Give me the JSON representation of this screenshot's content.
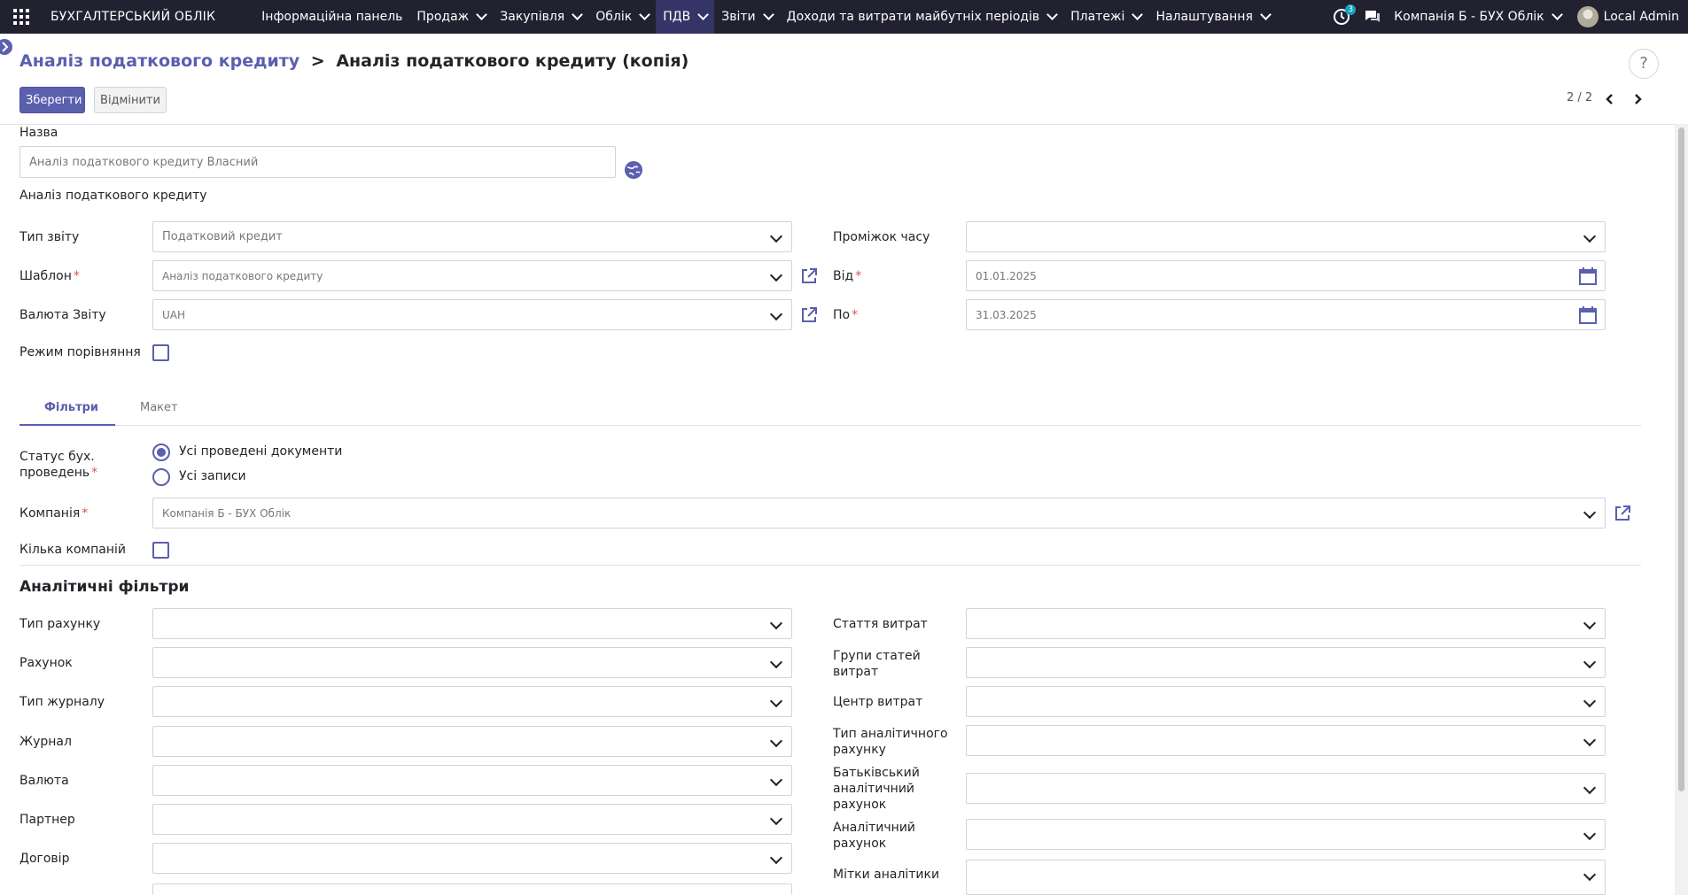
{
  "topbar": {
    "brand": "БУХГАЛТЕРСЬКИЙ ОБЛІК",
    "menu": [
      {
        "label": "Інформаційна панель",
        "has_caret": false,
        "active": false
      },
      {
        "label": "Продаж",
        "has_caret": true,
        "active": false
      },
      {
        "label": "Закупівля",
        "has_caret": true,
        "active": false
      },
      {
        "label": "Облік",
        "has_caret": true,
        "active": false
      },
      {
        "label": "ПДВ",
        "has_caret": true,
        "active": true
      },
      {
        "label": "Звіти",
        "has_caret": true,
        "active": false
      },
      {
        "label": "Доходи та витрати майбутніх періодів",
        "has_caret": true,
        "active": false
      },
      {
        "label": "Платежі",
        "has_caret": true,
        "active": false
      },
      {
        "label": "Налаштування",
        "has_caret": true,
        "active": false
      }
    ],
    "activity_count": "3",
    "company": "Компанія Б - БУХ Облік",
    "user": "Local Admin"
  },
  "breadcrumb": {
    "parent": "Аналіз податкового кредиту",
    "separator": ">",
    "current": "Аналіз податкового кредиту (копія)"
  },
  "help_label": "?",
  "actions": {
    "save": "Зберегти",
    "discard": "Відмінити"
  },
  "pager": {
    "value": "2 / 2"
  },
  "form": {
    "name_label": "Назва",
    "name_value": "Аналіз податкового кредиту Власний",
    "subtitle": "Аналіз податкового кредиту",
    "report_type_label": "Тип звіту",
    "report_type_value": "Податковий кредит",
    "template_label": "Шаблон",
    "template_value": "Аналіз податкового кредиту",
    "currency_label": "Валюта Звіту",
    "currency_value": "UAH",
    "compare_label": "Режим порівняння",
    "period_label": "Проміжок часу",
    "period_value": "",
    "from_label": "Від",
    "from_value": "01.01.2025",
    "to_label": "По",
    "to_value": "31.03.2025",
    "tabs": {
      "filters": "Фільтри",
      "layout": "Макет"
    },
    "status_label_1": "Статус бух.",
    "status_label_2": "проведень",
    "status_options": [
      "Усі проведені документи",
      "Усі записи"
    ],
    "company_label": "Компанія",
    "company_value": "Компанія Б - БУХ Облік",
    "multi_company_label": "Кілька компаній",
    "analytic_title": "Аналітичні фільтри",
    "left_filters": [
      "Тип рахунку",
      "Рахунок",
      "Тип журналу",
      "Журнал",
      "Валюта",
      "Партнер",
      "Договір"
    ],
    "right_filters": [
      {
        "line1": "Стаття витрат",
        "line2": "",
        "line3": ""
      },
      {
        "line1": "Групи статей",
        "line2": "витрат",
        "line3": ""
      },
      {
        "line1": "Центр витрат",
        "line2": "",
        "line3": ""
      },
      {
        "line1": "Тип аналітичного",
        "line2": "рахунку",
        "line3": ""
      },
      {
        "line1": "Батьківський",
        "line2": "аналітичний",
        "line3": "рахунок"
      },
      {
        "line1": "Аналітичний",
        "line2": "рахунок",
        "line3": ""
      },
      {
        "line1": "Мітки аналітики",
        "line2": "",
        "line3": ""
      }
    ]
  },
  "colors": {
    "accent": "#5a5fae",
    "topbar": "#212130",
    "active_menu": "#343466",
    "required": "#d9534f"
  }
}
